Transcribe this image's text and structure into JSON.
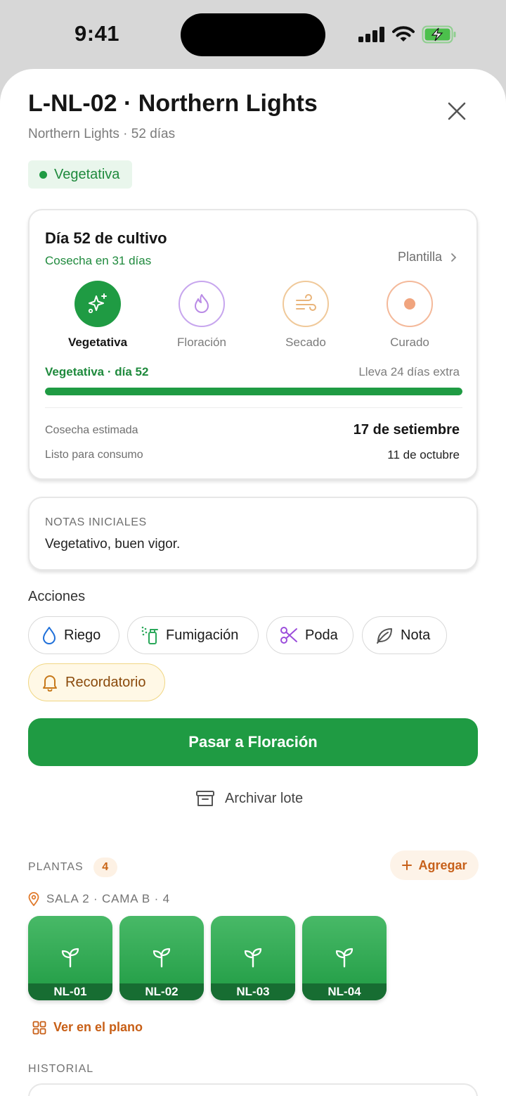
{
  "status_bar": {
    "time": "9:41"
  },
  "header": {
    "title": "L-NL-02 · Northern Lights",
    "subtitle": "Northern Lights · 52 días",
    "phase_chip": "Vegetativa"
  },
  "cycle": {
    "title": "Día 52 de cultivo",
    "harvest_in": "Cosecha en 31 días",
    "template_link": "Plantilla",
    "stages": [
      {
        "label": "Vegetativa",
        "icon": "sparkles-icon",
        "color": "#1f9b43",
        "active": true
      },
      {
        "label": "Floración",
        "icon": "flame-icon",
        "color": "#b98ae6",
        "active": false
      },
      {
        "label": "Secado",
        "icon": "wind-icon",
        "color": "#e9b47a",
        "active": false
      },
      {
        "label": "Curado",
        "icon": "dot-icon",
        "color": "#f0a47e",
        "active": false
      }
    ],
    "progress_label": "Vegetativa · día 52",
    "progress_extra": "Lleva 24 días extra",
    "progress": 1.0,
    "estimated_harvest_label": "Cosecha estimada",
    "estimated_harvest_value": "17 de setiembre",
    "ready_label": "Listo para consumo",
    "ready_value": "11 de octubre"
  },
  "notes": {
    "heading": "NOTAS INICIALES",
    "text": "Vegetativo, buen vigor."
  },
  "actions": {
    "label": "Acciones",
    "buttons": [
      {
        "label": "Riego",
        "icon": "droplet-icon"
      },
      {
        "label": "Fumigación",
        "icon": "spray-icon"
      },
      {
        "label": "Poda",
        "icon": "scissors-icon"
      },
      {
        "label": "Nota",
        "icon": "leaf-icon"
      },
      {
        "label": "Recordatorio",
        "icon": "bell-icon"
      }
    ],
    "primary": "Pasar a Floración",
    "archive": "Archivar lote"
  },
  "plants": {
    "label": "PLANTAS",
    "count": "4",
    "add_label": "Agregar",
    "location": "SALA 2 · CAMA B · 4",
    "items": [
      "NL-01",
      "NL-02",
      "NL-03",
      "NL-04"
    ],
    "plan_link": "Ver en el plano"
  },
  "history": {
    "label": "HISTORIAL"
  },
  "colors": {
    "accent": "#1f9b43",
    "accent_dark": "#176d32",
    "orange": "#c7601a"
  }
}
